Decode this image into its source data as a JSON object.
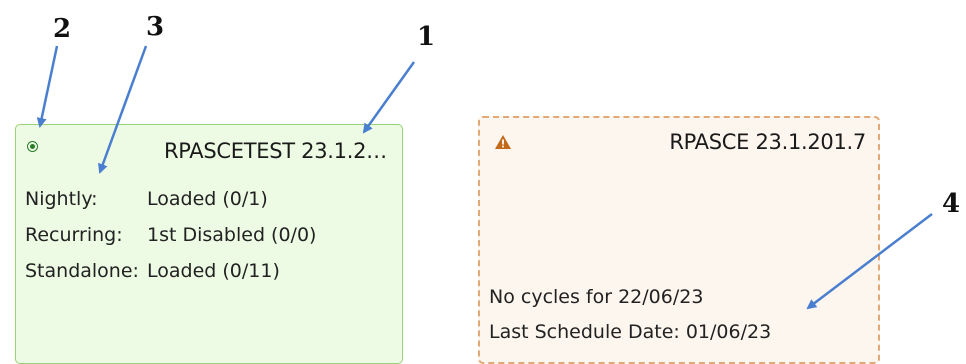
{
  "callouts": [
    "1",
    "2",
    "3",
    "4"
  ],
  "cards": [
    {
      "title": "RPASCETEST 23.1.2…",
      "status_icon": "success-status-icon",
      "accent_color": "#9ad27a",
      "background": "#eefbe4",
      "rows": [
        {
          "label": "Nightly:",
          "value": "Loaded (0/1)"
        },
        {
          "label": "Recurring:",
          "value": "1st Disabled (0/0)"
        },
        {
          "label": "Standalone:",
          "value": "Loaded (0/11)"
        }
      ]
    },
    {
      "title": "RPASCE 23.1.201.7",
      "status_icon": "warning-icon",
      "accent_color": "#e2a976",
      "warning_color": "#c26a1a",
      "background": "#fdf6ef",
      "messages": [
        "No cycles for 22/06/23",
        "Last Schedule Date: 01/06/23"
      ]
    }
  ],
  "arrow_color": "#4a7fd0"
}
